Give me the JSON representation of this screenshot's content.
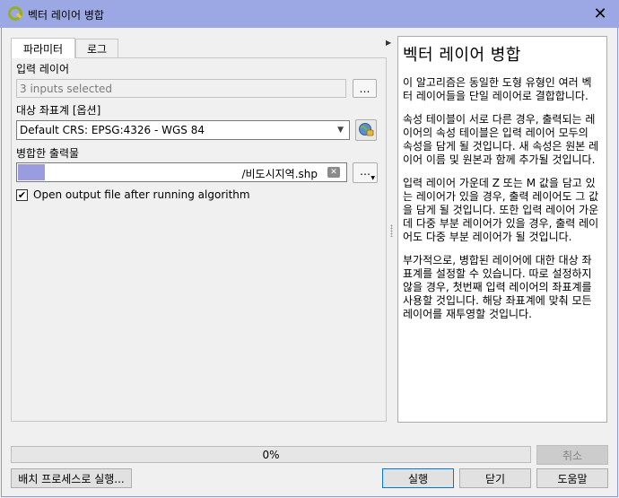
{
  "window": {
    "title": "벡터 레이어 병합",
    "close_symbol": "✕"
  },
  "tabs": [
    {
      "label": "파라미터"
    },
    {
      "label": "로그"
    }
  ],
  "params": {
    "input_layers_label": "입력 레이어",
    "input_layers_value": "3 inputs selected",
    "input_layers_button": "…",
    "crs_label": "대상 좌표계 [옵션]",
    "crs_value": "Default CRS: EPSG:4326 - WGS 84",
    "output_label": "병합한 출력물",
    "output_value": "/비도시지역.shp",
    "output_button": "…",
    "open_output_label": "Open output file after running algorithm",
    "open_output_checked": true
  },
  "help": {
    "title": "벡터 레이어 병합",
    "paragraphs": [
      "이 알고리즘은 동일한 도형 유형인 여러 벡터 레이어들을 단일 레이어로 결합합니다.",
      "속성 테이블이 서로 다른 경우, 출력되는 레이어의 속성 테이블은 입력 레이어 모두의 속성을 담게 될 것입니다. 새 속성은 원본 레이어 이름 및 원본과 함께 추가될 것입니다.",
      "입력 레이어 가운데 Z 또는 M 값을 담고 있는 레이어가 있을 경우, 출력 레이어도 그 값을 담게 될 것입니다. 또한 입력 레이어 가운데 다중 부분 레이어가 있을 경우, 출력 레이어도 다중 부분 레이어가 될 것입니다.",
      "부가적으로, 병합된 레이어에 대한 대상 좌표계를 설정할 수 있습니다. 따로 설정하지 않을 경우, 첫번째 입력 레이어의 좌표계를 사용할 것입니다. 해당 좌표계에 맞춰 모든 레이어를 재투영할 것입니다."
    ]
  },
  "progress": {
    "value_percent": 0,
    "text": "0%"
  },
  "buttons": {
    "cancel": "취소",
    "batch": "배치 프로세스로 실행...",
    "run": "실행",
    "close": "닫기",
    "help": "도움말"
  },
  "colors": {
    "titlebar": "#9ca8e3",
    "accent_border": "#0078d7",
    "qgis_green": "#93b023",
    "qgis_yellow": "#f3c43a"
  }
}
